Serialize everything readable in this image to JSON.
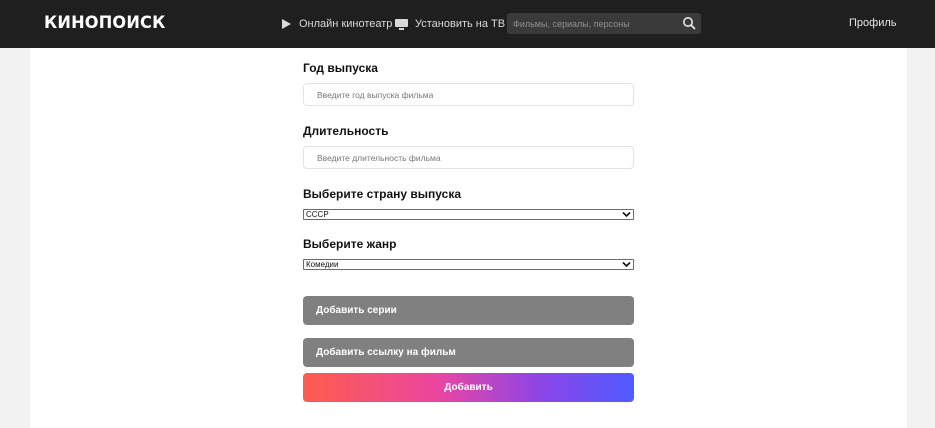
{
  "header": {
    "logo": "КИНОПОИСК",
    "nav": {
      "online": "Онлайн кинотеатр",
      "tv": "Установить на ТВ"
    },
    "search": {
      "placeholder": "Фильмы, сериалы, персоны",
      "value": ""
    },
    "profile": "Профиль"
  },
  "form": {
    "year": {
      "label": "Год выпуска",
      "placeholder": "Введите год выпуска фильма",
      "value": ""
    },
    "duration": {
      "label": "Длительность",
      "placeholder": "Введите длительность фильма",
      "value": ""
    },
    "country": {
      "label": "Выберите страну выпуска",
      "selected": "СССР"
    },
    "genre": {
      "label": "Выберите жанр",
      "selected": "Комедии"
    },
    "buttons": {
      "add_series": "Добавить серии",
      "add_link": "Добавить ссылку на фильм",
      "submit": "Добавить"
    }
  },
  "colors": {
    "header_bg": "#1f1f1f",
    "page_bg": "#f2f2f2",
    "button_gray": "#808080",
    "gradient": [
      "#ff5c4d",
      "#eb469f",
      "#8c45e8",
      "#4f5cff"
    ]
  },
  "icons": {
    "online": "play-icon",
    "tv": "tv-icon",
    "search": "search-icon",
    "select": "chevron-down-icon"
  }
}
